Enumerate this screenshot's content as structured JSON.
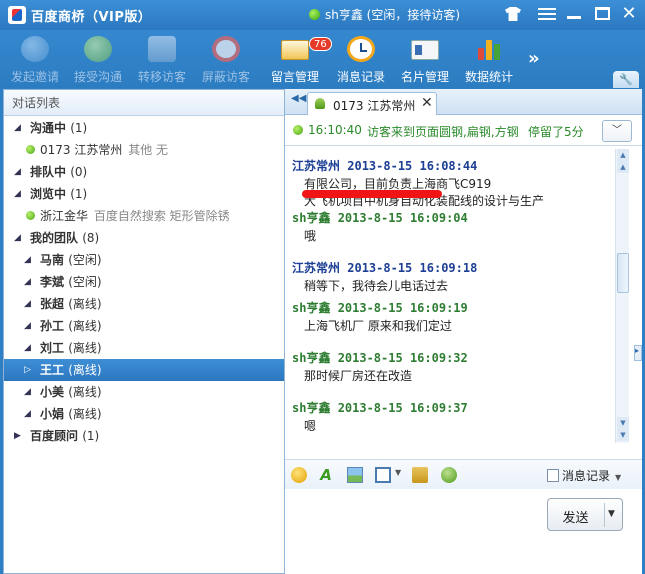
{
  "titlebar": {
    "title": "百度商桥（VIP版）",
    "user_status": "sh亨鑫 (空闲，接待访客)",
    "status_color": "#4caf16"
  },
  "toolbar": {
    "items": [
      {
        "label": "发起邀请",
        "icon": "invite-bubble-icon",
        "enabled": false
      },
      {
        "label": "接受沟通",
        "icon": "accept-chat-icon",
        "enabled": false
      },
      {
        "label": "转移访客",
        "icon": "transfer-visitor-icon",
        "enabled": false
      },
      {
        "label": "屏蔽访客",
        "icon": "block-visitor-icon",
        "enabled": false
      },
      {
        "label": "留言管理",
        "icon": "mail-icon",
        "enabled": true,
        "badge": "76"
      },
      {
        "label": "消息记录",
        "icon": "clock-icon",
        "enabled": true
      },
      {
        "label": "名片管理",
        "icon": "business-card-icon",
        "enabled": true
      },
      {
        "label": "数据统计",
        "icon": "bar-chart-icon",
        "enabled": true
      }
    ],
    "more": "»"
  },
  "left": {
    "header": "对话列表",
    "tree": [
      {
        "type": "group",
        "label": "沟通中",
        "count": "(1)",
        "expanded": true
      },
      {
        "type": "visitor",
        "id": "0173",
        "label": "江苏常州",
        "extra": "其他 无"
      },
      {
        "type": "group",
        "label": "排队中",
        "count": "(0)",
        "expanded": true
      },
      {
        "type": "group",
        "label": "浏览中",
        "count": "(1)",
        "expanded": true
      },
      {
        "type": "visitor",
        "id": "",
        "label": "浙江金华",
        "extra": "百度自然搜索 矩形管除锈"
      },
      {
        "type": "group",
        "label": "我的团队",
        "count": "(8)",
        "expanded": true
      },
      {
        "type": "member",
        "label": "马南",
        "status": "(空闲)"
      },
      {
        "type": "member",
        "label": "李斌",
        "status": "(空闲)"
      },
      {
        "type": "member",
        "label": "张超",
        "status": "(离线)"
      },
      {
        "type": "member",
        "label": "孙工",
        "status": "(离线)"
      },
      {
        "type": "member",
        "label": "刘工",
        "status": "(离线)"
      },
      {
        "type": "member",
        "label": "王工",
        "status": "(离线)",
        "selected": true
      },
      {
        "type": "member",
        "label": "小美",
        "status": "(离线)"
      },
      {
        "type": "member",
        "label": "小娟",
        "status": "(离线)"
      },
      {
        "type": "group",
        "label": "百度顾问",
        "count": "(1)",
        "expanded": false
      }
    ]
  },
  "chat": {
    "tab": {
      "id": "0173",
      "label": "0173 江苏常州"
    },
    "info": {
      "time": "16:10:40",
      "text": "访客来到页面圆钢,扁钢,方钢",
      "stay": "停留了5分"
    },
    "messages": [
      {
        "sender": "江苏常州",
        "role": "visitor",
        "date": "2013-8-15",
        "time": "16:08:44",
        "lines": [
          "                有限公司，目前负责上海商飞C919",
          "大飞机项目中机身自动化装配线的设计与生产"
        ]
      },
      {
        "sender": "sh亨鑫",
        "role": "agent",
        "date": "2013-8-15",
        "time": "16:09:04",
        "lines": [
          "哦"
        ]
      },
      {
        "sender": "江苏常州",
        "role": "visitor",
        "date": "2013-8-15",
        "time": "16:09:18",
        "lines": [
          "稍等下，我待会儿电话过去"
        ]
      },
      {
        "sender": "sh亨鑫",
        "role": "agent",
        "date": "2013-8-15",
        "time": "16:09:19",
        "lines": [
          "上海飞机厂 原来和我们定过"
        ]
      },
      {
        "sender": "sh亨鑫",
        "role": "agent",
        "date": "2013-8-15",
        "time": "16:09:32",
        "lines": [
          "那时候厂房还在改造"
        ]
      },
      {
        "sender": "sh亨鑫",
        "role": "agent",
        "date": "2013-8-15",
        "time": "16:09:37",
        "lines": [
          "嗯"
        ]
      }
    ],
    "input_toolbar": {
      "tools": [
        "emoji-icon",
        "font-icon",
        "image-icon",
        "screenshot-icon",
        "send-file-icon",
        "transfer-user-icon"
      ],
      "message_log": "消息记录"
    },
    "send_label": "发送",
    "colors": {
      "visitor": "#1c3f94",
      "agent": "#2e7d32",
      "notice": "#2a8a2a"
    }
  }
}
